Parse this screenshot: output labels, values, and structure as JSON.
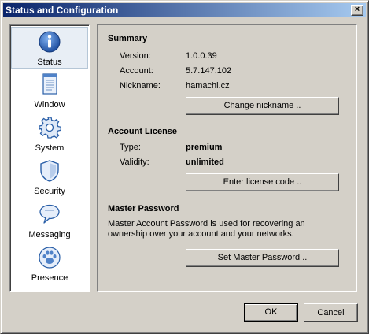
{
  "window": {
    "title": "Status and Configuration",
    "close_label": "×"
  },
  "sidebar": {
    "items": [
      {
        "label": "Status",
        "icon": "info-icon",
        "active": true
      },
      {
        "label": "Window",
        "icon": "window-icon",
        "active": false
      },
      {
        "label": "System",
        "icon": "gear-icon",
        "active": false
      },
      {
        "label": "Security",
        "icon": "shield-icon",
        "active": false
      },
      {
        "label": "Messaging",
        "icon": "speech-bubble-icon",
        "active": false
      },
      {
        "label": "Presence",
        "icon": "paw-icon",
        "active": false
      }
    ]
  },
  "summary": {
    "title": "Summary",
    "version_label": "Version:",
    "version_value": "1.0.0.39",
    "account_label": "Account:",
    "account_value": "5.7.147.102",
    "nickname_label": "Nickname:",
    "nickname_value": "hamachi.cz",
    "change_nickname_button": "Change nickname .."
  },
  "license": {
    "title": "Account License",
    "type_label": "Type:",
    "type_value": "premium",
    "validity_label": "Validity:",
    "validity_value": "unlimited",
    "enter_code_button": "Enter license code .."
  },
  "master_password": {
    "title": "Master Password",
    "description": "Master Account Password is used for recovering an ownership over your account and your networks.",
    "set_button": "Set Master Password .."
  },
  "footer": {
    "ok_label": "OK",
    "cancel_label": "Cancel"
  },
  "colors": {
    "title_gradient_start": "#0a246a",
    "title_gradient_end": "#a6caf0",
    "dialog_bg": "#d4d0c8",
    "icon_blue": "#2a5fa8"
  }
}
